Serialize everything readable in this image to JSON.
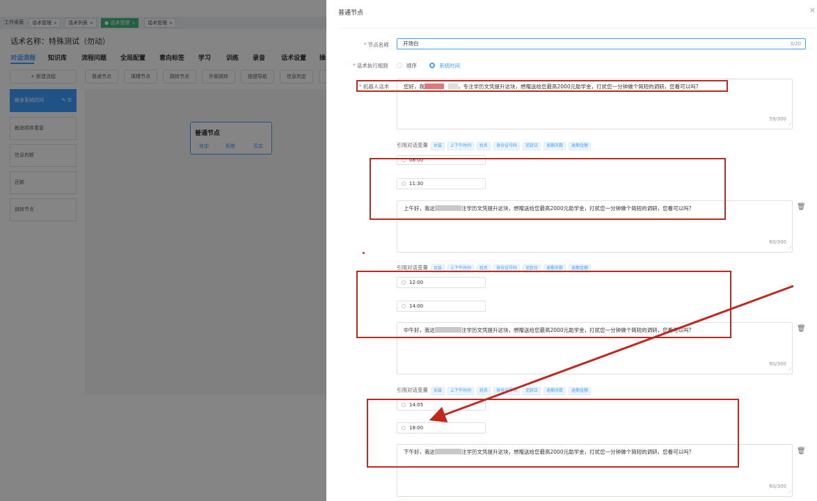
{
  "tabs": [
    {
      "label": "工作桌面",
      "closable": false
    },
    {
      "label": "话术管理",
      "closable": true
    },
    {
      "label": "话术列表",
      "closable": true
    },
    {
      "label": "话术管理",
      "closable": true,
      "active": true
    },
    {
      "label": "话术管理",
      "closable": true
    }
  ],
  "script_title": "话术名称：特殊测试（勿动）",
  "nav": [
    "对话流程",
    "知识库",
    "流程问题",
    "全局配置",
    "意向标签",
    "学习",
    "训练",
    "录音",
    "话术设置",
    "操"
  ],
  "toolbar": {
    "new_flow": "+ 新建流程",
    "node_buttons": [
      "普通节点",
      "填槽节点",
      "跳转节点",
      "外部跳转",
      "按键导航",
      "信息判定",
      "书"
    ]
  },
  "sidebar": [
    "触发系统时间",
    "触发顺序重复",
    "信息判断",
    "还款",
    "跳转节点"
  ],
  "node_card": {
    "title": "普通节点",
    "branches": [
      "肯定",
      "拒绝",
      "否定"
    ]
  },
  "drawer": {
    "title": "普通节点",
    "close": "×",
    "node_name_label": "节点名称",
    "node_name_value": "开场白",
    "node_name_count": "3/20",
    "rule_label": "话术执行规则",
    "rule_options": [
      "顺序",
      "系统时间"
    ],
    "robot_label": "机器人话术",
    "robot_text_a": "您好，我",
    "robot_text_b": "，专注学历文凭提升这块，想赠送给您最高2000元助学金，打扰您一分钟做个简短的调研，您看可以吗？",
    "robot_count": "59/300",
    "var_label": "引用对话变量",
    "var_tags": [
      "女装",
      "上下午时间",
      "姓名",
      "身份证号码",
      "还款日",
      "逾期天数",
      "逾期金额"
    ],
    "slots": [
      {
        "start": "08:00",
        "end": "11:30",
        "text_a": "上午好，我这",
        "text_b": "注学历文凭提升这块，想赠送给您最高2000元助学金，打扰您一分钟做个简短的调研，您看可以吗？",
        "count": "60/300"
      },
      {
        "start": "12:00",
        "end": "14:00",
        "text_a": "中午好，我这",
        "text_b": "注学历文凭提升这块，想赠送给您最高2000元助学金，打扰您一分钟做个简短的调研，您看可以吗？",
        "count": "60/300"
      },
      {
        "start": "14:05",
        "end": "18:00",
        "text_a": "下午好，我这",
        "text_b": "注学历文凭提升这块，想赠送给您最高2000元助学金，打扰您一分钟做个简短的调研，您看可以吗？",
        "count": "60/300"
      }
    ]
  },
  "colors": {
    "primary": "#409eff",
    "annotation": "#c0281e"
  },
  "icons": {
    "delete": "trash-icon",
    "clock": "clock-icon",
    "close": "close-icon"
  }
}
